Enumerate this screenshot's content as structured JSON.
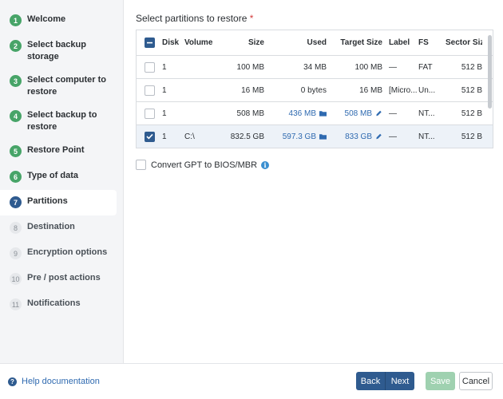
{
  "sidebar": {
    "steps": [
      {
        "num": "1",
        "label": "Welcome",
        "state": "done"
      },
      {
        "num": "2",
        "label": "Select backup storage",
        "state": "done"
      },
      {
        "num": "3",
        "label": "Select computer to restore",
        "state": "done"
      },
      {
        "num": "4",
        "label": "Select backup to restore",
        "state": "done"
      },
      {
        "num": "5",
        "label": "Restore Point",
        "state": "done"
      },
      {
        "num": "6",
        "label": "Type of data",
        "state": "done"
      },
      {
        "num": "7",
        "label": "Partitions",
        "state": "active"
      },
      {
        "num": "8",
        "label": "Destination",
        "state": "todo"
      },
      {
        "num": "9",
        "label": "Encryption options",
        "state": "todo"
      },
      {
        "num": "10",
        "label": "Pre / post actions",
        "state": "todo"
      },
      {
        "num": "11",
        "label": "Notifications",
        "state": "todo"
      }
    ]
  },
  "main": {
    "title": "Select partitions to restore",
    "required_mark": "*",
    "table": {
      "headers": {
        "disk": "Disk",
        "volume": "Volume",
        "size": "Size",
        "used": "Used",
        "target_size": "Target Size",
        "label": "Label",
        "fs": "FS",
        "sector_size": "Sector Size"
      },
      "rows": [
        {
          "checked": false,
          "disk": "1",
          "volume": "",
          "size": "100 MB",
          "used": "34 MB",
          "used_link": false,
          "target_size": "100 MB",
          "target_editable": false,
          "label": "—",
          "fs": "FAT",
          "sector_size": "512 B"
        },
        {
          "checked": false,
          "disk": "1",
          "volume": "",
          "size": "16 MB",
          "used": "0 bytes",
          "used_link": false,
          "target_size": "16 MB",
          "target_editable": false,
          "label": "[Micro...",
          "fs": "Un...",
          "sector_size": "512 B"
        },
        {
          "checked": false,
          "disk": "1",
          "volume": "",
          "size": "508 MB",
          "used": "436 MB",
          "used_link": true,
          "target_size": "508 MB",
          "target_editable": true,
          "label": "—",
          "fs": "NT...",
          "sector_size": "512 B"
        },
        {
          "checked": true,
          "disk": "1",
          "volume": "C:\\",
          "size": "832.5 GB",
          "used": "597.3 GB",
          "used_link": true,
          "target_size": "833 GB",
          "target_editable": true,
          "label": "—",
          "fs": "NT...",
          "sector_size": "512 B"
        }
      ]
    },
    "convert_option": {
      "label": "Convert GPT to BIOS/MBR",
      "checked": false,
      "info_icon": "i"
    }
  },
  "footer": {
    "help_icon": "?",
    "help_label": "Help documentation",
    "back_label": "Back",
    "next_label": "Next",
    "save_label": "Save",
    "cancel_label": "Cancel"
  }
}
